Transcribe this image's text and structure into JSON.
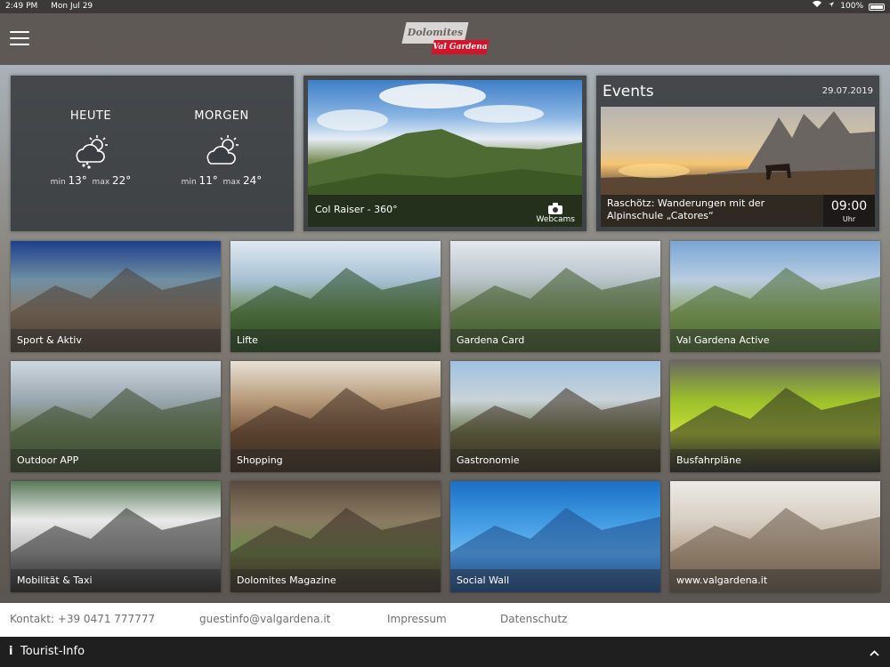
{
  "status_bar": {
    "time": "2:49 PM",
    "date": "Mon Jul 29",
    "battery": "100%"
  },
  "header": {
    "logo_top": "Dolomites",
    "logo_bottom": "Val Gardena",
    "menu_icon": "hamburger-icon"
  },
  "weather": {
    "today": {
      "label": "HEUTE",
      "min_label": "min",
      "min": "13°",
      "max_label": "max",
      "max": "22°",
      "icon": "sun-cloud-rain-icon"
    },
    "tomorrow": {
      "label": "MORGEN",
      "min_label": "min",
      "min": "11°",
      "max_label": "max",
      "max": "24°",
      "icon": "sun-cloud-icon"
    }
  },
  "webcam": {
    "caption": "Col Raiser - 360°",
    "link_label": "Webcams",
    "icon": "camera-icon"
  },
  "events": {
    "title": "Events",
    "date": "29.07.2019",
    "event_title": "Raschötz: Wanderungen mit der Alpinschule „Catores“",
    "time": "09:00",
    "time_unit": "Uhr"
  },
  "tiles": [
    {
      "label": "Sport & Aktiv",
      "colors": [
        "#1e3f8a",
        "#6f8fa3",
        "#8a7a6a",
        "#4a4035"
      ]
    },
    {
      "label": "Lifte",
      "colors": [
        "#dfe9f2",
        "#a9c0d3",
        "#6b8a55",
        "#2c4a22"
      ]
    },
    {
      "label": "Gardena Card",
      "colors": [
        "#e4e9ee",
        "#b8c3c9",
        "#7e8f6a",
        "#3f5a2a"
      ]
    },
    {
      "label": "Val Gardena Active",
      "colors": [
        "#7aa6d6",
        "#b9cde0",
        "#8ea56a",
        "#4a6a32"
      ]
    },
    {
      "label": "Outdoor APP",
      "colors": [
        "#cfd8e0",
        "#9aa6ae",
        "#6b7a5a",
        "#3a4a2e"
      ]
    },
    {
      "label": "Shopping",
      "colors": [
        "#e8e1d6",
        "#b79a7a",
        "#7a5a3e",
        "#3e2e22"
      ]
    },
    {
      "label": "Gastronomie",
      "colors": [
        "#9fc1e2",
        "#c9d3d8",
        "#6f7a52",
        "#3a3020"
      ]
    },
    {
      "label": "Busfahrpläne",
      "colors": [
        "#6a6a62",
        "#9cbf2a",
        "#c6de3a",
        "#2a2a24"
      ]
    },
    {
      "label": "Mobilität & Taxi",
      "colors": [
        "#5a7a5a",
        "#eaeaea",
        "#b8b8b8",
        "#2a2a2a"
      ]
    },
    {
      "label": "Dolomites Magazine",
      "colors": [
        "#5a4a3e",
        "#8a7a62",
        "#6a8a4a",
        "#3a2e26"
      ]
    },
    {
      "label": "Social Wall",
      "colors": [
        "#1a6fc4",
        "#3f9ae2",
        "#6ab8f0",
        "#1f4d8a"
      ]
    },
    {
      "label": "www.valgardena.it",
      "colors": [
        "#eceae6",
        "#d8cfc4",
        "#b8a48e",
        "#6a5a4a"
      ]
    }
  ],
  "footer": {
    "contact": "Kontakt: +39 0471 777777",
    "email": "guestinfo@valgardena.it",
    "impressum": "Impressum",
    "privacy": "Datenschutz"
  },
  "tourist_bar": {
    "info_glyph": "i",
    "label": "Tourist-Info",
    "icon": "chevron-up-icon"
  }
}
